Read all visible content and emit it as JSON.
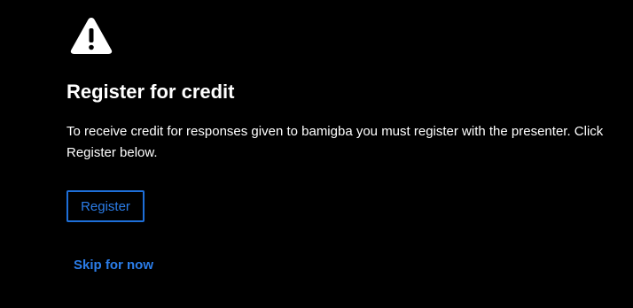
{
  "dialog": {
    "icon": "warning-icon",
    "title": "Register for credit",
    "message": "To receive credit for responses given to bamigba you must register with the presenter. Click Register below.",
    "register_label": "Register",
    "skip_label": "Skip for now"
  },
  "colors": {
    "background": "#000000",
    "text": "#ffffff",
    "accent": "#2b7de9"
  }
}
